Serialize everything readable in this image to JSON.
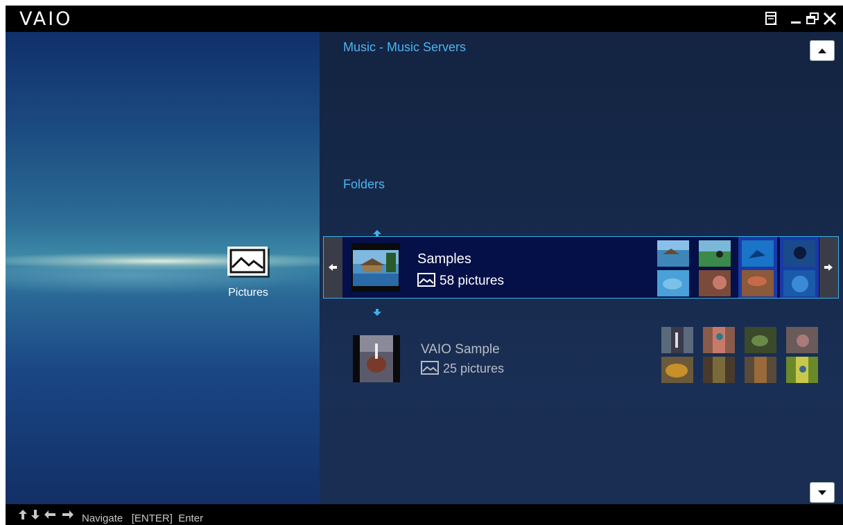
{
  "app": {
    "logo": "VAIO"
  },
  "window_controls": [
    {
      "name": "mini-mode-icon"
    },
    {
      "name": "minimize-icon"
    },
    {
      "name": "restore-icon"
    },
    {
      "name": "close-icon"
    }
  ],
  "left_panel": {
    "category_label": "Pictures",
    "category_icon": "picture-icon"
  },
  "right_panel": {
    "breadcrumb": "Music - Music Servers",
    "folders_heading": "Folders",
    "folders": [
      {
        "name": "Samples",
        "count": "58 pictures",
        "selected": true,
        "thumbs": [
          "#3f86b8",
          "#3a8a4a",
          "#1a74c8",
          "#1a4a8a",
          "#4aa0d8",
          "#7a4a3a",
          "#8a5a3a",
          "#1a5aa8"
        ]
      },
      {
        "name": "VAIO Sample",
        "count": "25 pictures",
        "selected": false,
        "thumbs": [
          "#5a6a7a",
          "#8a5a4a",
          "#3a4a2a",
          "#6a5a5a",
          "#6a5a3a",
          "#4a3a2a",
          "#5a4a3a",
          "#6a8a2a"
        ]
      }
    ]
  },
  "status_bar": {
    "hint": "Navigate   [ENTER]  Enter"
  },
  "colors": {
    "accent": "#4db4f0",
    "selected_row": "#051048",
    "right_panel_bg": "#16294a"
  }
}
